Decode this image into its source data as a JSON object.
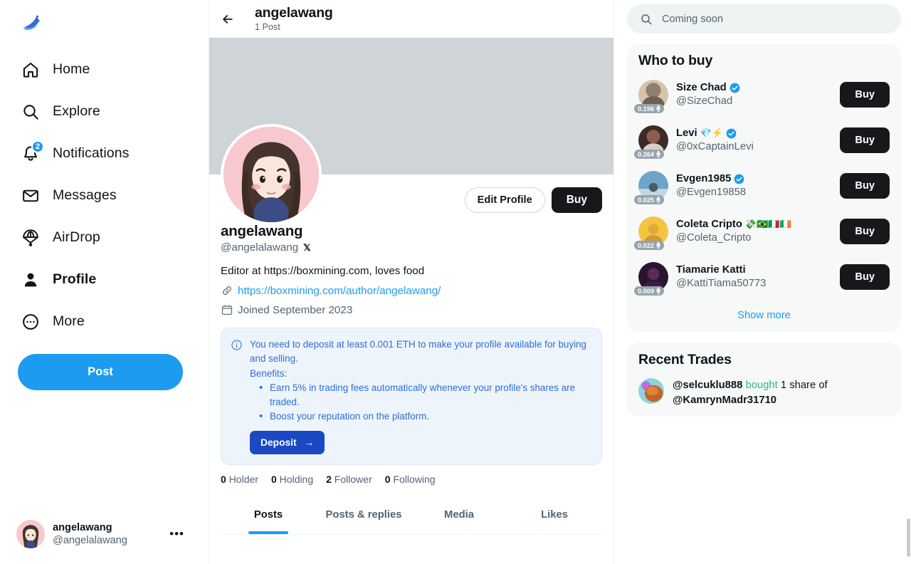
{
  "brand": {
    "logo_icon": "bird-logo",
    "accent": "#1d9bf0"
  },
  "sidebar": {
    "items": [
      {
        "label": "Home",
        "icon": "home-icon",
        "badge": null,
        "active": false
      },
      {
        "label": "Explore",
        "icon": "search-icon",
        "badge": null,
        "active": false
      },
      {
        "label": "Notifications",
        "icon": "bell-icon",
        "badge": "2",
        "active": false
      },
      {
        "label": "Messages",
        "icon": "envelope-icon",
        "badge": null,
        "active": false
      },
      {
        "label": "AirDrop",
        "icon": "parachute-icon",
        "badge": null,
        "active": false
      },
      {
        "label": "Profile",
        "icon": "person-icon",
        "badge": null,
        "active": true
      },
      {
        "label": "More",
        "icon": "more-circle-icon",
        "badge": null,
        "active": false
      }
    ],
    "post_button": "Post",
    "account": {
      "name": "angelawang",
      "handle": "@angelalawang",
      "menu_icon": "ellipsis-icon"
    }
  },
  "header": {
    "back_icon": "back-arrow-icon",
    "title": "angelawang",
    "subtitle": "1 Post"
  },
  "profile": {
    "banner_color": "#cfd4d9",
    "edit_button": "Edit Profile",
    "buy_button": "Buy",
    "display_name": "angelawang",
    "handle": "@angelalawang",
    "platform_glyph": "𝕏",
    "bio": "Editor at https://boxmining.com, loves food",
    "link_icon": "link-icon",
    "link_text": "https://boxmining.com/author/angelawang/",
    "calendar_icon": "calendar-icon",
    "joined": "Joined September 2023",
    "notice": {
      "info_icon": "info-icon",
      "line1": "You need to deposit at least 0.001 ETH to make your profile available for buying and selling.",
      "line2": "Benefits:",
      "bullets": [
        "Earn 5% in trading fees automatically whenever your profile's shares are traded.",
        "Boost your reputation on the platform."
      ],
      "deposit_button": "Deposit",
      "deposit_arrow": "→"
    },
    "stats": [
      {
        "value": "0",
        "label": "Holder"
      },
      {
        "value": "0",
        "label": "Holding"
      },
      {
        "value": "2",
        "label": "Follower"
      },
      {
        "value": "0",
        "label": "Following"
      }
    ],
    "tabs": [
      {
        "label": "Posts",
        "active": true
      },
      {
        "label": "Posts & replies",
        "active": false
      },
      {
        "label": "Media",
        "active": false
      },
      {
        "label": "Likes",
        "active": false
      }
    ]
  },
  "search": {
    "icon": "search-icon",
    "placeholder": "Coming soon",
    "value": ""
  },
  "who_to_buy": {
    "title": "Who to buy",
    "buy_label": "Buy",
    "show_more": "Show more",
    "people": [
      {
        "name": "Size Chad",
        "handle": "@SizeChad",
        "price": "0.196",
        "verified": true,
        "emojis": "",
        "avatar_colors": [
          "#8f7f70",
          "#d6c3ad"
        ]
      },
      {
        "name": "Levi",
        "handle": "@0xCaptainLevi",
        "price": "0.264",
        "verified": true,
        "emojis": "💎⚡",
        "avatar_colors": [
          "#3b2b28",
          "#8d5d52"
        ]
      },
      {
        "name": "Evgen1985",
        "handle": "@Evgen19858",
        "price": "0.025",
        "verified": true,
        "emojis": "",
        "avatar_colors": [
          "#6fa4c9",
          "#c3d6e2"
        ]
      },
      {
        "name": "Coleta Cripto",
        "handle": "@Coleta_Cripto",
        "price": "0.022",
        "verified": false,
        "emojis": "💸🇧🇷🇮🇹🇮🇪",
        "avatar_colors": [
          "#f5c542",
          "#e0a93a"
        ]
      },
      {
        "name": "Tiamarie Katti",
        "handle": "@KattiTiama50773",
        "price": "0.009",
        "verified": false,
        "emojis": "",
        "avatar_colors": [
          "#5b2a58",
          "#2a1430"
        ]
      }
    ]
  },
  "recent_trades": {
    "title": "Recent Trades",
    "items": [
      {
        "actor": "@selcuklu888",
        "verb": "bought",
        "detail": "1 share of",
        "target": "@KamrynMadr31710"
      }
    ]
  }
}
